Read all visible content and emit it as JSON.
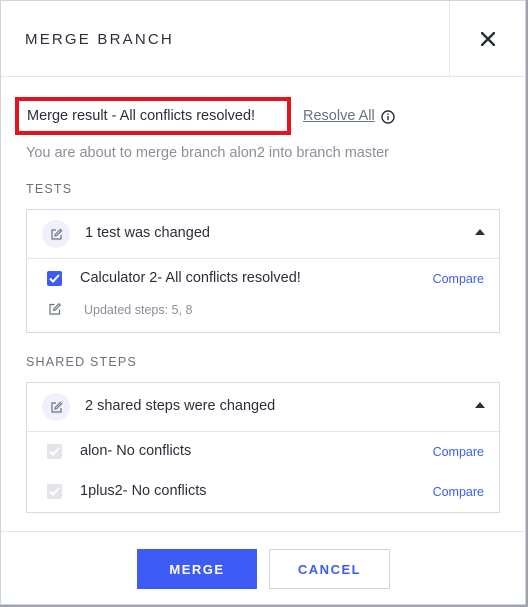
{
  "dialog": {
    "title": "MERGE BRANCH",
    "close_icon": "close-icon"
  },
  "result": {
    "message": "Merge result - All conflicts resolved!",
    "resolve_all_label": "Resolve All",
    "info_icon": "info-icon",
    "description": "You are about to merge branch alon2 into branch master"
  },
  "tests": {
    "section_label": "TESTS",
    "header_label": "1 test was changed",
    "header_icon": "edit-icon",
    "items": [
      {
        "label": "Calculator 2- All conflicts resolved!",
        "checked": true,
        "compare_label": "Compare"
      }
    ],
    "updated_steps": "Updated steps: 5, 8"
  },
  "shared_steps": {
    "section_label": "SHARED STEPS",
    "header_label": "2 shared steps were changed",
    "header_icon": "edit-icon",
    "items": [
      {
        "label": "alon- No conflicts",
        "checked": true,
        "disabled": true,
        "compare_label": "Compare"
      },
      {
        "label": "1plus2- No conflicts",
        "checked": true,
        "disabled": true,
        "compare_label": "Compare"
      }
    ]
  },
  "footer": {
    "merge_label": "MERGE",
    "cancel_label": "CANCEL"
  },
  "colors": {
    "accent": "#3d5cf5",
    "highlight_border": "#e3141c",
    "muted_text": "#8a8f99"
  }
}
